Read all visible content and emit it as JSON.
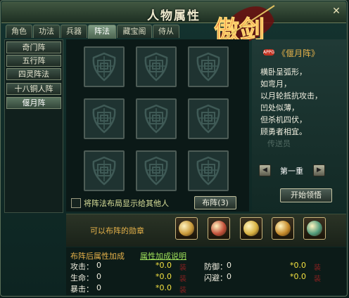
{
  "window": {
    "title": "人物属性",
    "close_symbol": "✕",
    "logo_text": "傲剑"
  },
  "tabs": [
    {
      "label": "角色",
      "active": false
    },
    {
      "label": "功法",
      "active": false
    },
    {
      "label": "兵器",
      "active": false
    },
    {
      "label": "阵法",
      "active": true
    },
    {
      "label": "藏宝阁",
      "active": false
    },
    {
      "label": "侍从",
      "active": false
    }
  ],
  "formations": [
    {
      "label": "奇门阵",
      "selected": false
    },
    {
      "label": "五行阵",
      "selected": false
    },
    {
      "label": "四灵阵法",
      "selected": false
    },
    {
      "label": "十八铜人阵",
      "selected": false
    },
    {
      "label": "偃月阵",
      "selected": true
    }
  ],
  "grid": {
    "rows": 3,
    "cols": 3,
    "cell_icon": "shield-knot-icon",
    "show_layout_label": "将阵法布局显示给其他人",
    "formation_button": "布阵(3)"
  },
  "detail": {
    "badge": "APPG",
    "name": "《偃月阵》",
    "description": [
      "横卧呈弧形，",
      "如弯月，",
      "以月轮抵抗攻击，",
      "凹处似薄，",
      "但杀机四伏，",
      "顾勇者相宜。"
    ],
    "faded_text": "传送员",
    "level": "第一重",
    "prev_icon": "left-arrow-icon",
    "next_icon": "right-arrow-icon",
    "learn_button": "开始领悟"
  },
  "medals": {
    "label": "可以布阵的勋章",
    "items": [
      {
        "icon": "warrior-medal-icon",
        "color": "#c99a3a"
      },
      {
        "icon": "red-seal-medal-icon",
        "color": "#c2503a"
      },
      {
        "icon": "gold-ring-medal-icon",
        "color": "#d7b040"
      },
      {
        "icon": "bronze-coin-medal-icon",
        "color": "#c68a2a"
      },
      {
        "icon": "jade-orb-medal-icon",
        "color": "#4f9a7a"
      }
    ]
  },
  "stats": {
    "title": "布阵后属性加成",
    "help_link": "属性加成说明",
    "rows": [
      {
        "label": "攻击：",
        "value": "0",
        "bonus": "*0.0",
        "tag": "装"
      },
      {
        "label": "生命：",
        "value": "0",
        "bonus": "*0.0",
        "tag": "装"
      },
      {
        "label": "暴击：",
        "value": "0",
        "bonus": "*0.0",
        "tag": "装"
      },
      {
        "label": "防御：",
        "value": "0",
        "bonus": "*0.0",
        "tag": "装"
      },
      {
        "label": "闪避：",
        "value": "0",
        "bonus": "*0.0",
        "tag": "装"
      }
    ]
  },
  "colors": {
    "accent": "#e6b24a",
    "link": "#9fe05a",
    "bonus": "#f2e040",
    "panel_bg": "#14332f"
  }
}
